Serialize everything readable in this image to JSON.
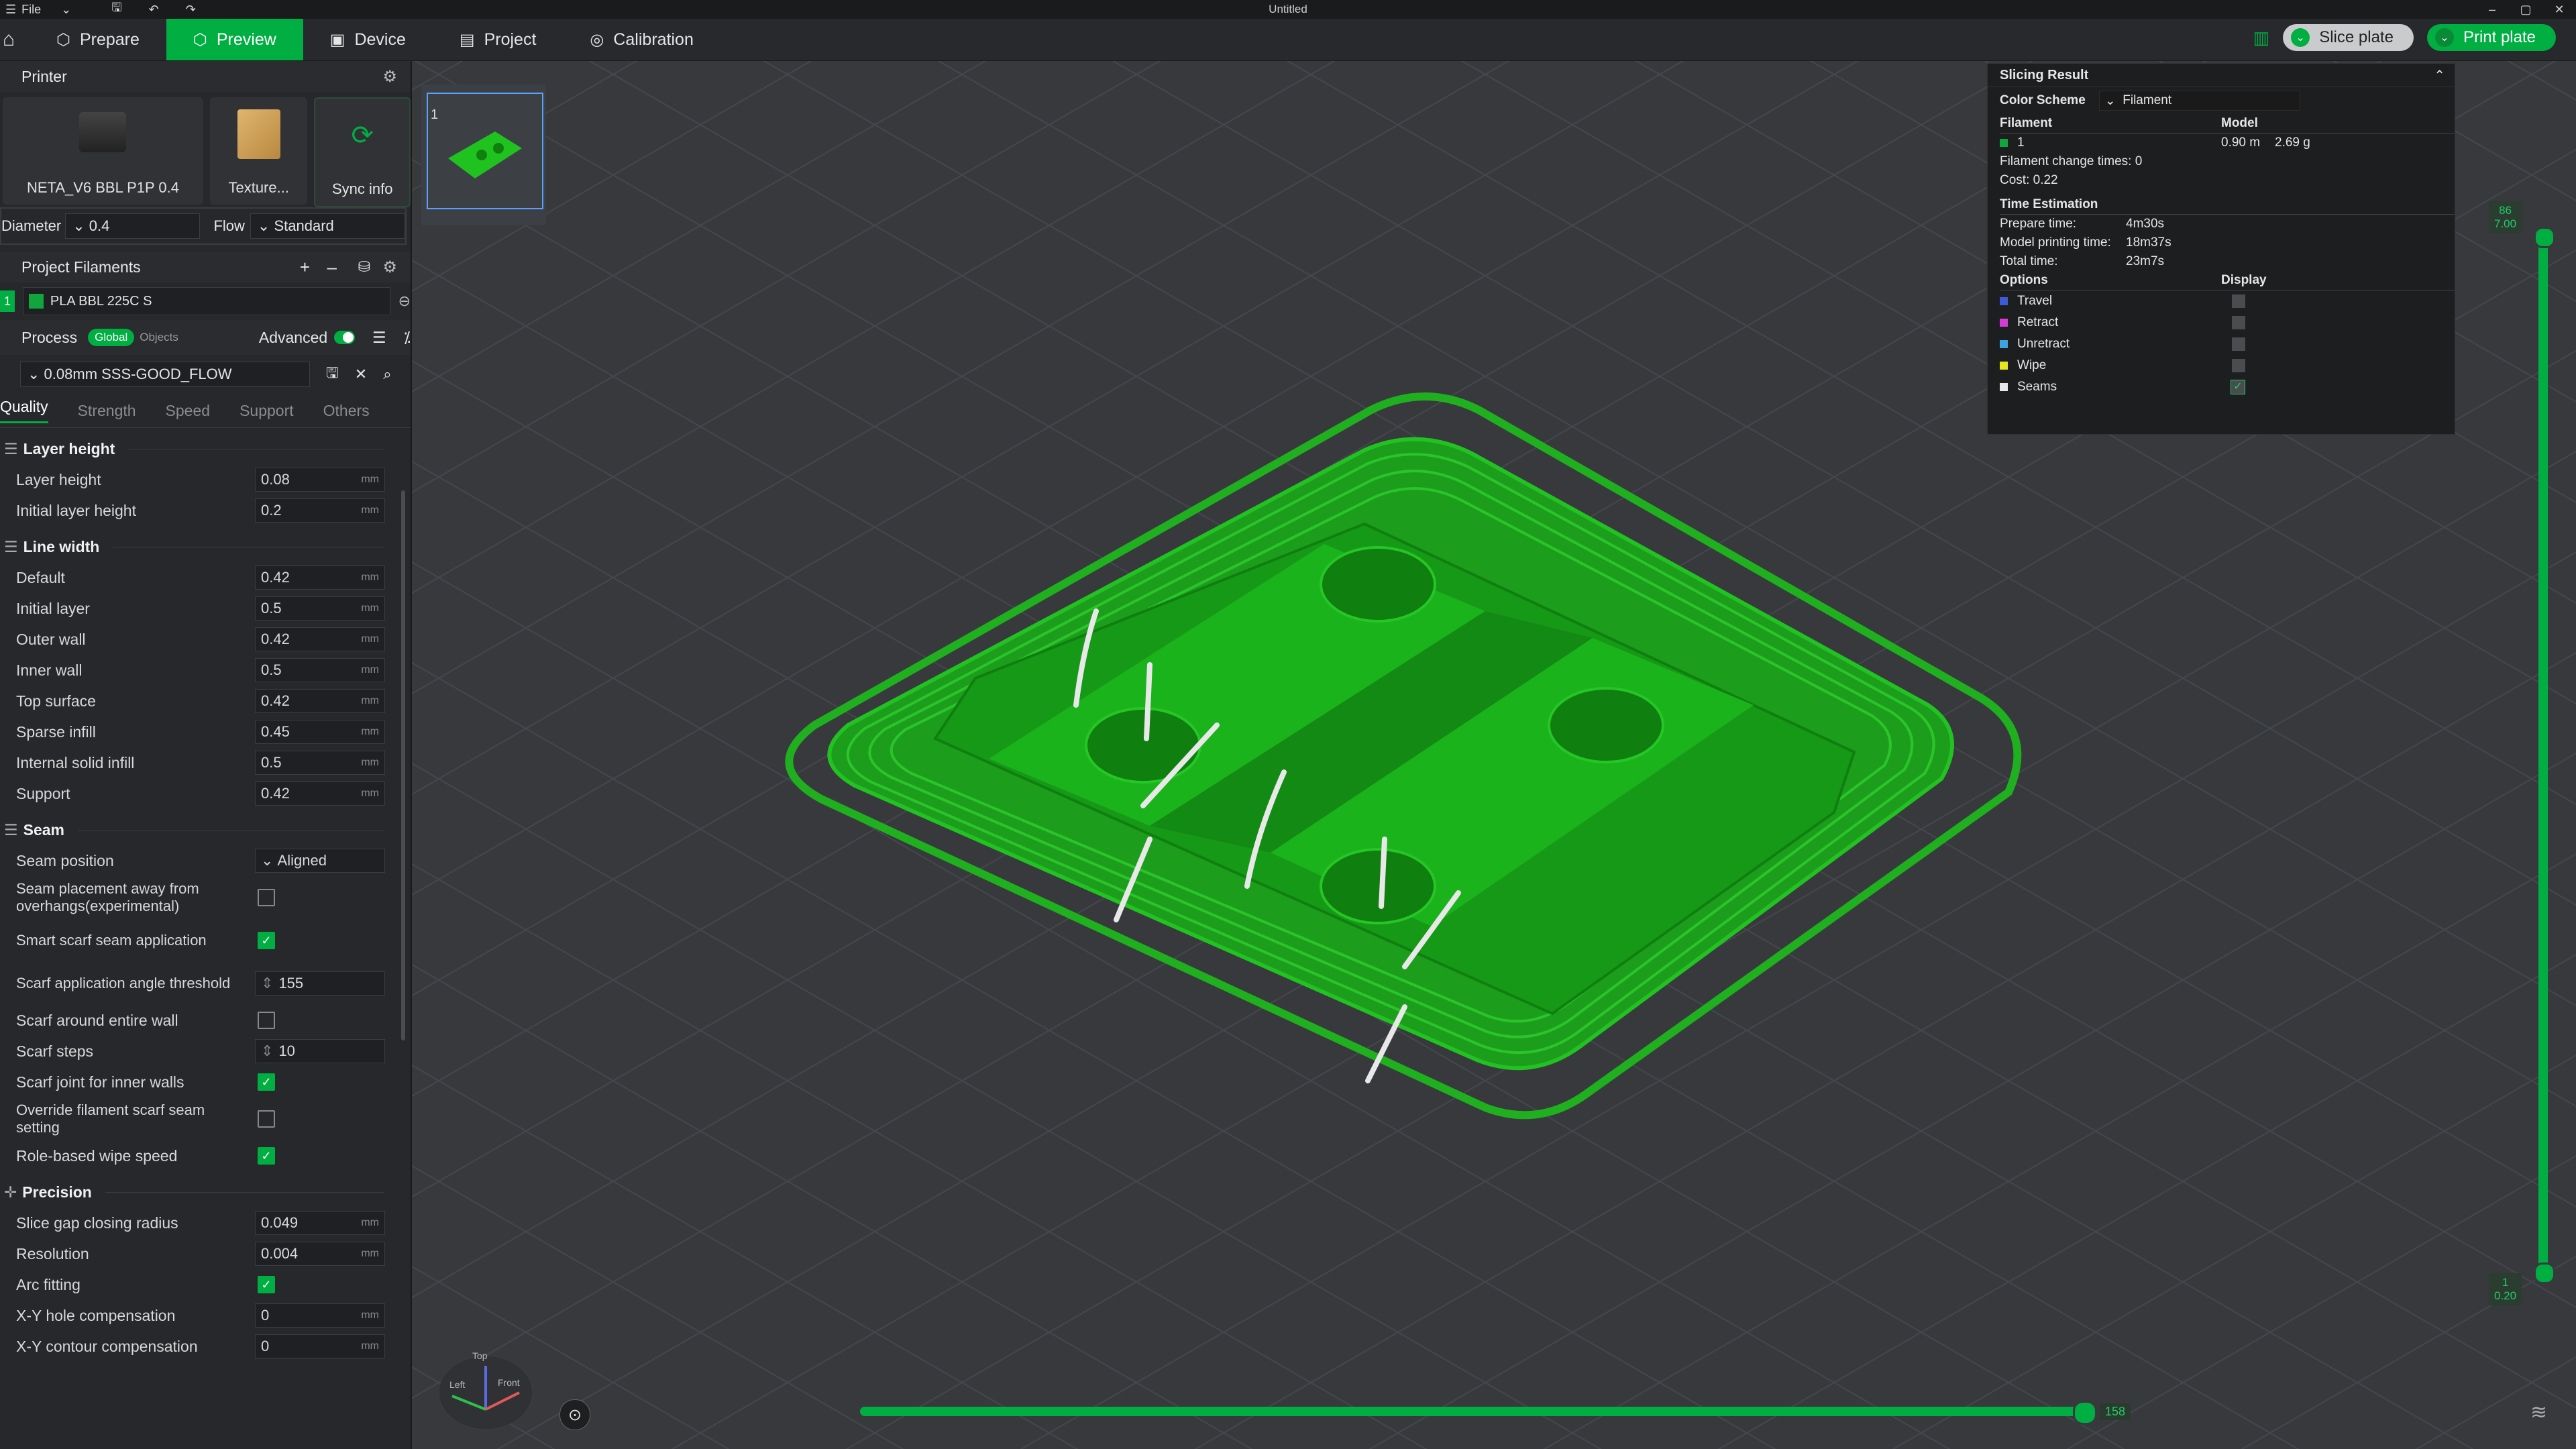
{
  "titlebar": {
    "file_menu": "File",
    "title": "Untitled"
  },
  "tabs": {
    "prepare": "Prepare",
    "preview": "Preview",
    "device": "Device",
    "project": "Project",
    "calibration": "Calibration"
  },
  "actions": {
    "slice": "Slice plate",
    "print": "Print plate"
  },
  "printer": {
    "header": "Printer",
    "printer_name": "NETA_V6 BBL P1P 0.4",
    "plate": "Texture...",
    "sync": "Sync info",
    "diameter_label": "Diameter",
    "diameter_value": "0.4",
    "flow_label": "Flow",
    "flow_value": "Standard"
  },
  "filaments": {
    "header": "Project Filaments",
    "items": [
      {
        "num": "1",
        "name": "PLA BBL 225C S",
        "color": "#11a63d"
      }
    ]
  },
  "process": {
    "header": "Process",
    "scope_global": "Global",
    "scope_objects": "Objects",
    "advanced": "Advanced",
    "preset": "0.08mm SSS-GOOD_FLOW",
    "tabs": [
      "Quality",
      "Strength",
      "Speed",
      "Support",
      "Others"
    ]
  },
  "groups": {
    "layer_height": {
      "title": "Layer height",
      "rows": [
        {
          "label": "Layer height",
          "value": "0.08",
          "unit": "mm"
        },
        {
          "label": "Initial layer height",
          "value": "0.2",
          "unit": "mm"
        }
      ]
    },
    "line_width": {
      "title": "Line width",
      "rows": [
        {
          "label": "Default",
          "value": "0.42",
          "unit": "mm"
        },
        {
          "label": "Initial layer",
          "value": "0.5",
          "unit": "mm"
        },
        {
          "label": "Outer wall",
          "value": "0.42",
          "unit": "mm"
        },
        {
          "label": "Inner wall",
          "value": "0.5",
          "unit": "mm"
        },
        {
          "label": "Top surface",
          "value": "0.42",
          "unit": "mm"
        },
        {
          "label": "Sparse infill",
          "value": "0.45",
          "unit": "mm"
        },
        {
          "label": "Internal solid infill",
          "value": "0.5",
          "unit": "mm"
        },
        {
          "label": "Support",
          "value": "0.42",
          "unit": "mm"
        }
      ]
    },
    "seam": {
      "title": "Seam",
      "position_label": "Seam position",
      "position_value": "Aligned",
      "away_label": "Seam placement away from overhangs(experimental)",
      "smart_label": "Smart scarf seam application",
      "angle_label": "Scarf application angle threshold",
      "angle_value": "155",
      "entire_label": "Scarf around entire wall",
      "steps_label": "Scarf steps",
      "steps_value": "10",
      "joint_label": "Scarf joint for inner walls",
      "override_label": "Override filament scarf seam setting",
      "wipe_label": "Role-based wipe speed"
    },
    "precision": {
      "title": "Precision",
      "gap_label": "Slice gap closing radius",
      "gap_value": "0.049",
      "res_label": "Resolution",
      "res_value": "0.004",
      "arc_label": "Arc fitting",
      "xyhole_label": "X-Y hole compensation",
      "xyhole_value": "0",
      "xycont_label": "X-Y contour compensation",
      "xycont_value": "0",
      "unit": "mm"
    }
  },
  "plate_thumb": {
    "num": "1"
  },
  "slicing": {
    "title": "Slicing Result",
    "color_scheme_label": "Color Scheme",
    "color_scheme_value": "Filament",
    "col_filament": "Filament",
    "col_model": "Model",
    "fil_num": "1",
    "fil_len": "0.90 m",
    "fil_weight": "2.69 g",
    "change_times": "Filament change times:  0",
    "cost": "Cost:  0.22",
    "time_title": "Time Estimation",
    "prepare_label": "Prepare time:",
    "prepare_value": "4m30s",
    "model_label": "Model printing time:",
    "model_value": "18m37s",
    "total_label": "Total time:",
    "total_value": "23m7s",
    "options_label": "Options",
    "display_label": "Display",
    "options": [
      {
        "name": "Travel",
        "color": "#3c5bd8"
      },
      {
        "name": "Retract",
        "color": "#d43cd4"
      },
      {
        "name": "Unretract",
        "color": "#3ca3e0"
      },
      {
        "name": "Wipe",
        "color": "#e6e61e"
      },
      {
        "name": "Seams",
        "color": "#e8e8e8"
      }
    ]
  },
  "sliders": {
    "h_value": "158",
    "v_top_a": "86",
    "v_top_b": "7.00",
    "v_bot_a": "1",
    "v_bot_b": "0.20"
  },
  "axis": {
    "top": "Top",
    "left": "Left",
    "front": "Front"
  }
}
